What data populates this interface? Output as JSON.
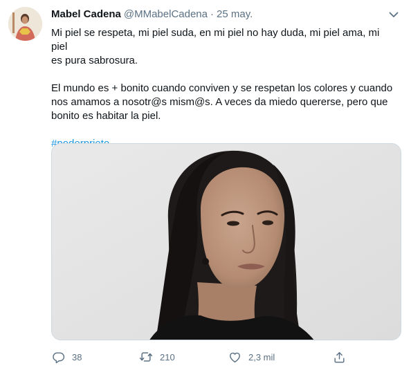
{
  "tweet": {
    "author_name": "Mabel Cadena",
    "handle": "@MMabelCadena",
    "separator": "·",
    "date": "25 may.",
    "paragraphs": [
      "Mi piel se respeta, mi piel suda, en mi piel no hay duda, mi piel ama, mi piel\nes pura sabrosura.",
      "El mundo es + bonito cuando conviven y se respetan los colores y cuando\nnos amamos a nosotr@s mism@s. A veces da miedo quererse, pero que\nbonito es habitar la piel."
    ],
    "hashtag": "#poderprieto"
  },
  "actions": {
    "reply_count": "38",
    "retweet_count": "210",
    "like_count": "2,3 mil"
  },
  "colors": {
    "text": "#0f1419",
    "secondary": "#5b7083",
    "link": "#1b95e0",
    "border": "#cfd9de"
  },
  "icons": {
    "more": "chevron-down-icon",
    "reply": "reply-icon",
    "retweet": "retweet-icon",
    "like": "heart-icon",
    "share": "share-icon"
  }
}
